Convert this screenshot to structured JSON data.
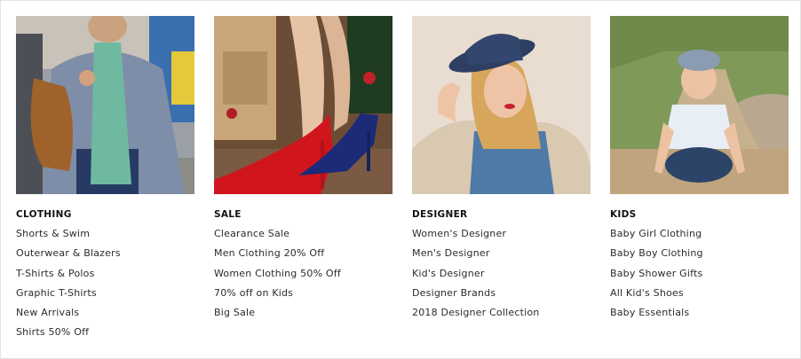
{
  "menu": {
    "columns": [
      {
        "heading": "CLOTHING",
        "image": "man-in-blazer-with-scarf-photo",
        "links": [
          "Shorts & Swim",
          "Outerwear & Blazers",
          "T-Shirts & Polos",
          "Graphic T-Shirts",
          "New Arrivals",
          "Shirts 50% Off"
        ]
      },
      {
        "heading": "SALE",
        "image": "red-and-blue-high-heels-photo",
        "links": [
          "Clearance Sale",
          "Men Clothing 20% Off",
          "Women Clothing 50% Off",
          "70% off on Kids",
          "Big Sale"
        ]
      },
      {
        "heading": "DESIGNER",
        "image": "woman-in-blue-hat-denim-shirt-photo",
        "links": [
          "Women's Designer",
          "Men's Designer",
          "Kid's Designer",
          "Designer Brands",
          "2018 Designer Collection"
        ]
      },
      {
        "heading": "KIDS",
        "image": "child-in-cap-on-dirt-road-photo",
        "links": [
          "Baby Girl Clothing",
          "Baby Boy Clothing",
          "Baby Shower Gifts",
          "All Kid's Shoes",
          "Baby Essentials"
        ]
      }
    ]
  }
}
